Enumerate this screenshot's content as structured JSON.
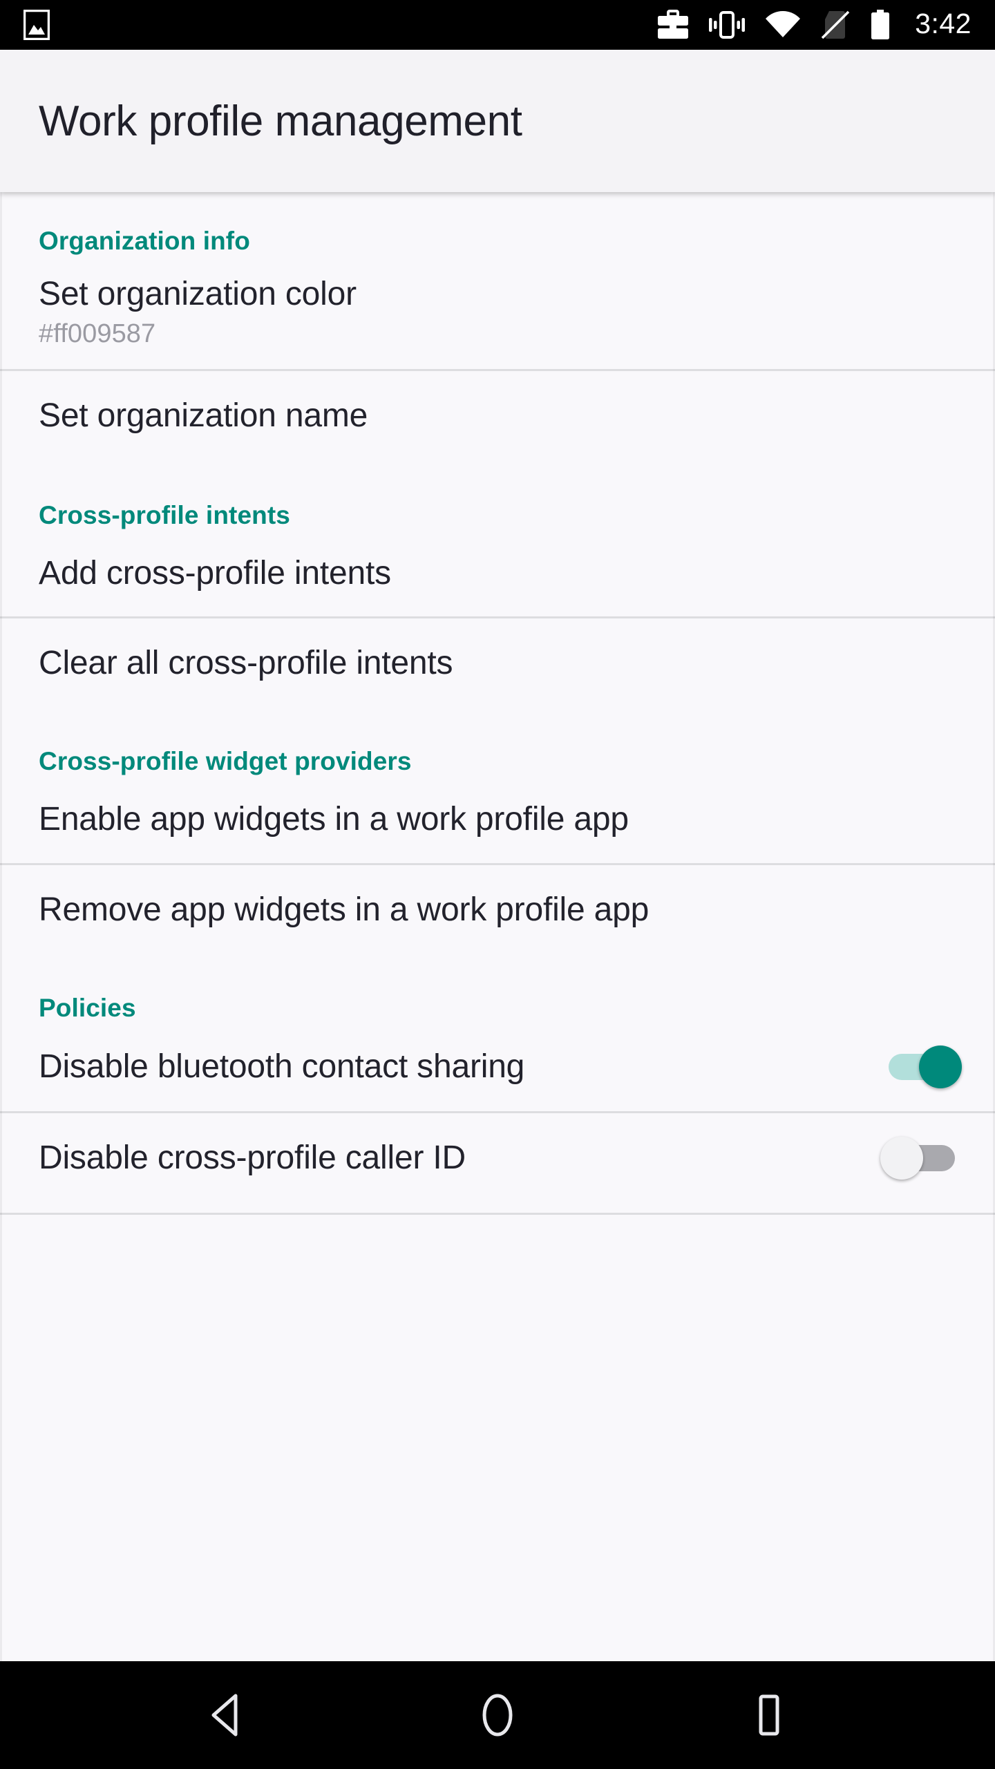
{
  "statusbar": {
    "time": "3:42",
    "icons_left": [
      "screenshot-icon"
    ],
    "icons_right": [
      "work-briefcase-icon",
      "vibrate-icon",
      "wifi-icon",
      "no-sim-icon",
      "battery-icon"
    ]
  },
  "appbar": {
    "title": "Work profile management"
  },
  "colors": {
    "accent_teal": "#00897b",
    "background": "#f9f8fb",
    "appbar_background": "#f4f3f6",
    "divider": "#dddde0",
    "switch_on_track": "#b2dfdb",
    "switch_on_thumb": "#00897b",
    "switch_off_track": "#a9a9ae",
    "switch_off_thumb": "#f2f2f4"
  },
  "sections": [
    {
      "header": "Organization info",
      "rows": [
        {
          "title": "Set organization color",
          "summary": "#ff009587",
          "switch": null
        },
        {
          "title": "Set organization name",
          "summary": null,
          "switch": null
        }
      ]
    },
    {
      "header": "Cross-profile intents",
      "rows": [
        {
          "title": "Add cross-profile intents",
          "summary": null,
          "switch": null
        },
        {
          "title": "Clear all cross-profile intents",
          "summary": null,
          "switch": null
        }
      ]
    },
    {
      "header": "Cross-profile widget providers",
      "rows": [
        {
          "title": "Enable app widgets in a work profile app",
          "summary": null,
          "switch": null
        },
        {
          "title": "Remove app widgets in a work profile app",
          "summary": null,
          "switch": null
        }
      ]
    },
    {
      "header": "Policies",
      "rows": [
        {
          "title": "Disable bluetooth contact sharing",
          "summary": null,
          "switch": "on"
        },
        {
          "title": "Disable cross-profile caller ID",
          "summary": null,
          "switch": "off"
        }
      ]
    }
  ],
  "navbar": {
    "buttons": [
      "back-button",
      "home-button",
      "recents-button"
    ]
  }
}
